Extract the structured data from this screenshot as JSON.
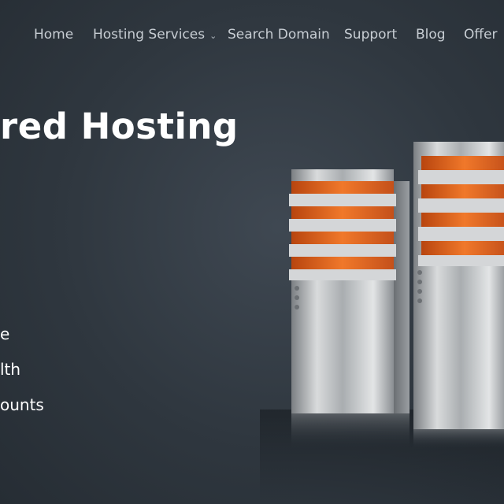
{
  "nav": {
    "items": [
      {
        "label": "Home"
      },
      {
        "label": "Hosting Services",
        "has_dropdown": true
      },
      {
        "label": "Search Domain"
      },
      {
        "label": "Support"
      },
      {
        "label": "Blog"
      },
      {
        "label": "Offer"
      }
    ],
    "dropdown_icon": "chevron-down-icon"
  },
  "hero": {
    "title": "red Hosting",
    "features": [
      "e",
      "lth",
      "ounts"
    ]
  },
  "colors": {
    "background": "#2f373f",
    "nav_text": "#c7cdd3",
    "title_text": "#ffffff",
    "accent_orange": "#e8621c",
    "server_metal": "#b9bcbf"
  },
  "illustration": "server-towers-image"
}
